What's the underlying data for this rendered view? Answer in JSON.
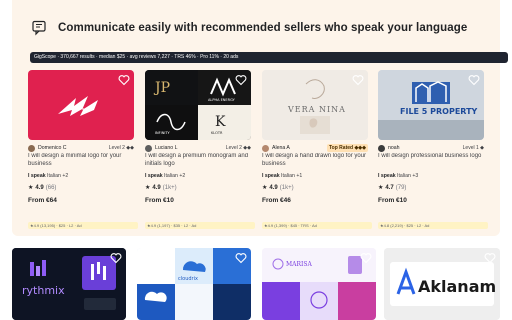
{
  "header": {
    "icon": "chat-translate-icon",
    "title": "Communicate easily with recommended sellers who speak your language"
  },
  "stats_bar": "GigScope · 370,667 results · median $25 · avg reviews 7,227 · TRS 46% · Pro 11% · 20 ads",
  "cards": [
    {
      "seller": "Domenico C",
      "level": "Level 2 ◆◆",
      "title": "I will design a minimal logo for your business",
      "speaks_label": "I speak",
      "language": "Italian +2",
      "rating": "4.9",
      "reviews": "(66)",
      "price": "From €64",
      "meta": "★4.9 (13,195) · $25 · L2 · Ad"
    },
    {
      "seller": "Luciano L",
      "level": "Level 2 ◆◆",
      "title": "I will design a premium monogram and initials logo",
      "speaks_label": "I speak",
      "language": "Italian +2",
      "rating": "4.9",
      "reviews": "(1k+)",
      "price": "From €10",
      "meta": "★4.9 (1,197) · $35 · L2 · Ad"
    },
    {
      "seller": "Alena A",
      "level": "Top Rated ◆◆◆",
      "title": "I will design a hand drawn logo for your business",
      "speaks_label": "I speak",
      "language": "Italian +1",
      "rating": "4.9",
      "reviews": "(1k+)",
      "price": "From €46",
      "meta": "★4.9 (1,399) · $45 · TRS · Ad"
    },
    {
      "seller": "noah",
      "level": "Level 1 ◆",
      "title": "I will design professional business logo",
      "speaks_label": "I speak",
      "language": "Italian +3",
      "rating": "4.7",
      "reviews": "(79)",
      "price": "From €10",
      "meta": "★4.8 (2,219) · $25 · L2 · Ad"
    }
  ],
  "thumb_texts": {
    "card2_logos": [
      "JP",
      "ALPHA ENERGY",
      "INFINITY",
      "KLOTR"
    ],
    "card3_logo": "VERA NINA",
    "card4_logo": "FILE 5 PROPERTY"
  },
  "bottom_cards": [
    {
      "brand": "rythmix"
    },
    {
      "brand": "cloudrix"
    },
    {
      "brand": "MARISA"
    },
    {
      "brand": "Aklanam"
    }
  ],
  "colors": {
    "panel_bg": "#fdf4ea",
    "stats_bg": "#1f2430",
    "card1_bg": "#e0214f",
    "top_rated": "#ffe0b3",
    "meta_bg": "#fff3c4"
  }
}
